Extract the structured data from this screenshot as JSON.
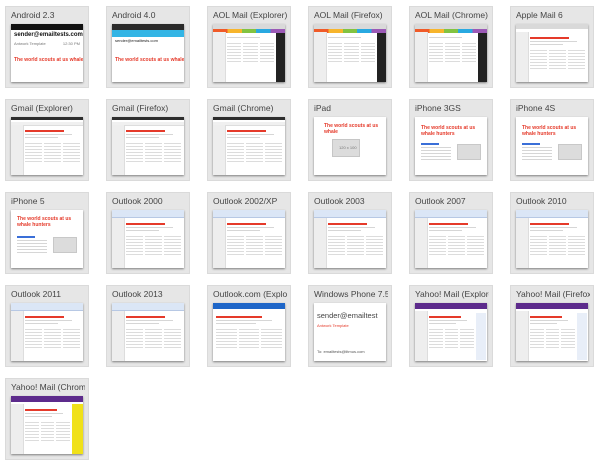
{
  "previews": [
    {
      "title": "Android 2.3",
      "style": "android23"
    },
    {
      "title": "Android 4.0",
      "style": "android40"
    },
    {
      "title": "AOL Mail (Explorer)",
      "style": "aol"
    },
    {
      "title": "AOL Mail (Firefox)",
      "style": "aol"
    },
    {
      "title": "AOL Mail (Chrome)",
      "style": "aol"
    },
    {
      "title": "Apple Mail 6",
      "style": "apple"
    },
    {
      "title": "Gmail (Explorer)",
      "style": "gmail"
    },
    {
      "title": "Gmail (Firefox)",
      "style": "gmail"
    },
    {
      "title": "Gmail (Chrome)",
      "style": "gmail"
    },
    {
      "title": "iPad",
      "style": "ipad"
    },
    {
      "title": "iPhone 3GS",
      "style": "iphone"
    },
    {
      "title": "iPhone 4S",
      "style": "iphone"
    },
    {
      "title": "iPhone 5",
      "style": "iphone5"
    },
    {
      "title": "Outlook 2000",
      "style": "outlook"
    },
    {
      "title": "Outlook 2002/XP",
      "style": "outlook"
    },
    {
      "title": "Outlook 2003",
      "style": "outlook"
    },
    {
      "title": "Outlook 2007",
      "style": "outlook"
    },
    {
      "title": "Outlook 2010",
      "style": "outlook"
    },
    {
      "title": "Outlook 2011",
      "style": "outlook"
    },
    {
      "title": "Outlook 2013",
      "style": "outlook"
    },
    {
      "title": "Outlook.com (Explorer)",
      "style": "outlookcom"
    },
    {
      "title": "Windows Phone 7.5",
      "style": "winphone"
    },
    {
      "title": "Yahoo! Mail (Explorer)",
      "style": "yahoo"
    },
    {
      "title": "Yahoo! Mail (Firefox)",
      "style": "yahoo"
    },
    {
      "title": "Yahoo! Mail (Chrome)",
      "style": "yahoochrome"
    }
  ],
  "thumb_text": {
    "sender": "sender@emailtests.com",
    "sender_short": "sender@emailtests.com",
    "template": "Antwork Template",
    "template_title": "Antwork Template",
    "phone_time": "1:40 PM",
    "phone_time2": "12:30 PM",
    "headline": "The world scouts at us whale hunters",
    "headline_short": "The world scouts at us whale",
    "byline": "Herman Melville",
    "body_snip": "It's worse than being in the whited sepulchre, the last day of the year! Who'll go climbing after chestnuts now? But",
    "image_caption": "120 x 100",
    "wp_sender": "sender@emailtest",
    "wp_template": "Antwork Template",
    "wp_to": "To: emailtests@litmus.com"
  },
  "colors": {
    "card_bg": "#e6e6e6",
    "accent_red": "#e53a2a",
    "link_blue": "#3a6fd8",
    "outlook_blue": "#1e66c8",
    "yahoo_purple": "#5d2b8c"
  }
}
